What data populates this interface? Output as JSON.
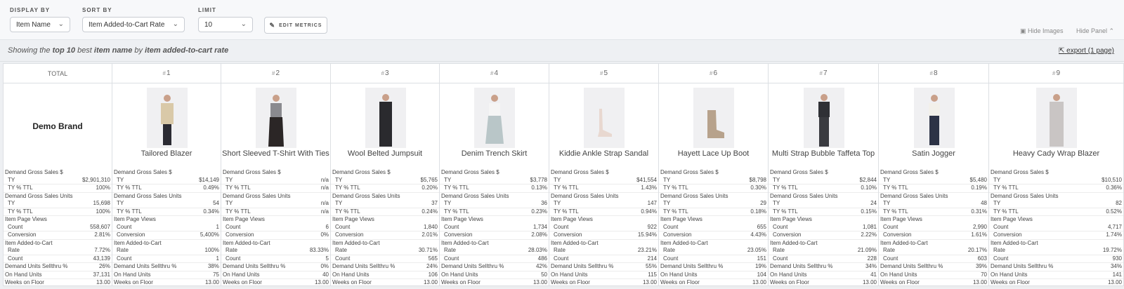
{
  "toolbar": {
    "display_by_label": "DISPLAY BY",
    "display_by_value": "Item Name",
    "sort_by_label": "SORT BY",
    "sort_by_value": "Item Added-to-Cart Rate",
    "limit_label": "LIMIT",
    "limit_value": "10",
    "edit_metrics": "EDIT METRICS",
    "hide_images": "Hide Images",
    "hide_panel": "Hide Panel"
  },
  "summary": {
    "prefix": "Showing the ",
    "top": "top 10",
    "mid1": " best ",
    "dim": "item name",
    "mid2": " by ",
    "metric": "item added-to-cart rate",
    "export": "export (1 page)"
  },
  "total": {
    "header": "TOTAL",
    "brand": "Demo Brand",
    "m": [
      "$2,901,310",
      "100%",
      "15,698",
      "100%",
      "558,607",
      "2.81%",
      "7.72%",
      "43,139",
      "26%",
      "37,131",
      "13.00"
    ]
  },
  "labels": {
    "dgs": "Demand Gross Sales $",
    "ty": "TY",
    "typct": "TY % TTL",
    "dgsu": "Demand Gross Sales Units",
    "ipv": "Item Page Views",
    "count": "Count",
    "conversion": "Conversion",
    "iatc": "Item Added-to-Cart",
    "rate": "Rate",
    "dus": "Demand Units Sellthru %",
    "ohu": "On Hand Units",
    "wof": "Weeks on Floor"
  },
  "items": [
    {
      "rank": "1",
      "name": "Tailored Blazer",
      "m": [
        "$14,149",
        "0.49%",
        "54",
        "0.34%",
        "1",
        "5,400%",
        "100%",
        "1",
        "38%",
        "75",
        "13.00"
      ]
    },
    {
      "rank": "2",
      "name": "Short Sleeved T-Shirt With Ties",
      "m": [
        "n/a",
        "n/a",
        "n/a",
        "n/a",
        "6",
        "0%",
        "83.33%",
        "5",
        "0%",
        "40",
        "13.00"
      ]
    },
    {
      "rank": "3",
      "name": "Wool Belted Jumpsuit",
      "m": [
        "$5,765",
        "0.20%",
        "37",
        "0.24%",
        "1,840",
        "2.01%",
        "30.71%",
        "565",
        "24%",
        "106",
        "13.00"
      ]
    },
    {
      "rank": "4",
      "name": "Denim Trench Skirt",
      "m": [
        "$3,778",
        "0.13%",
        "36",
        "0.23%",
        "1,734",
        "2.08%",
        "28.03%",
        "486",
        "42%",
        "50",
        "13.00"
      ]
    },
    {
      "rank": "5",
      "name": "Kiddie Ankle Strap Sandal",
      "m": [
        "$41,554",
        "1.43%",
        "147",
        "0.94%",
        "922",
        "15.94%",
        "23.21%",
        "214",
        "55%",
        "115",
        "13.00"
      ]
    },
    {
      "rank": "6",
      "name": "Hayett Lace Up Boot",
      "m": [
        "$8,798",
        "0.30%",
        "29",
        "0.18%",
        "655",
        "4.43%",
        "23.05%",
        "151",
        "19%",
        "104",
        "13.00"
      ]
    },
    {
      "rank": "7",
      "name": "Multi Strap Bubble Taffeta Top",
      "m": [
        "$2,844",
        "0.10%",
        "24",
        "0.15%",
        "1,081",
        "2.22%",
        "21.09%",
        "228",
        "34%",
        "41",
        "13.00"
      ]
    },
    {
      "rank": "8",
      "name": "Satin Jogger",
      "m": [
        "$5,480",
        "0.19%",
        "48",
        "0.31%",
        "2,990",
        "1.61%",
        "20.17%",
        "603",
        "39%",
        "70",
        "13.00"
      ]
    },
    {
      "rank": "9",
      "name": "Heavy Cady Wrap Blazer",
      "m": [
        "$10,510",
        "0.36%",
        "82",
        "0.52%",
        "4,717",
        "1.74%",
        "19.72%",
        "930",
        "34%",
        "141",
        "13.00"
      ]
    }
  ]
}
